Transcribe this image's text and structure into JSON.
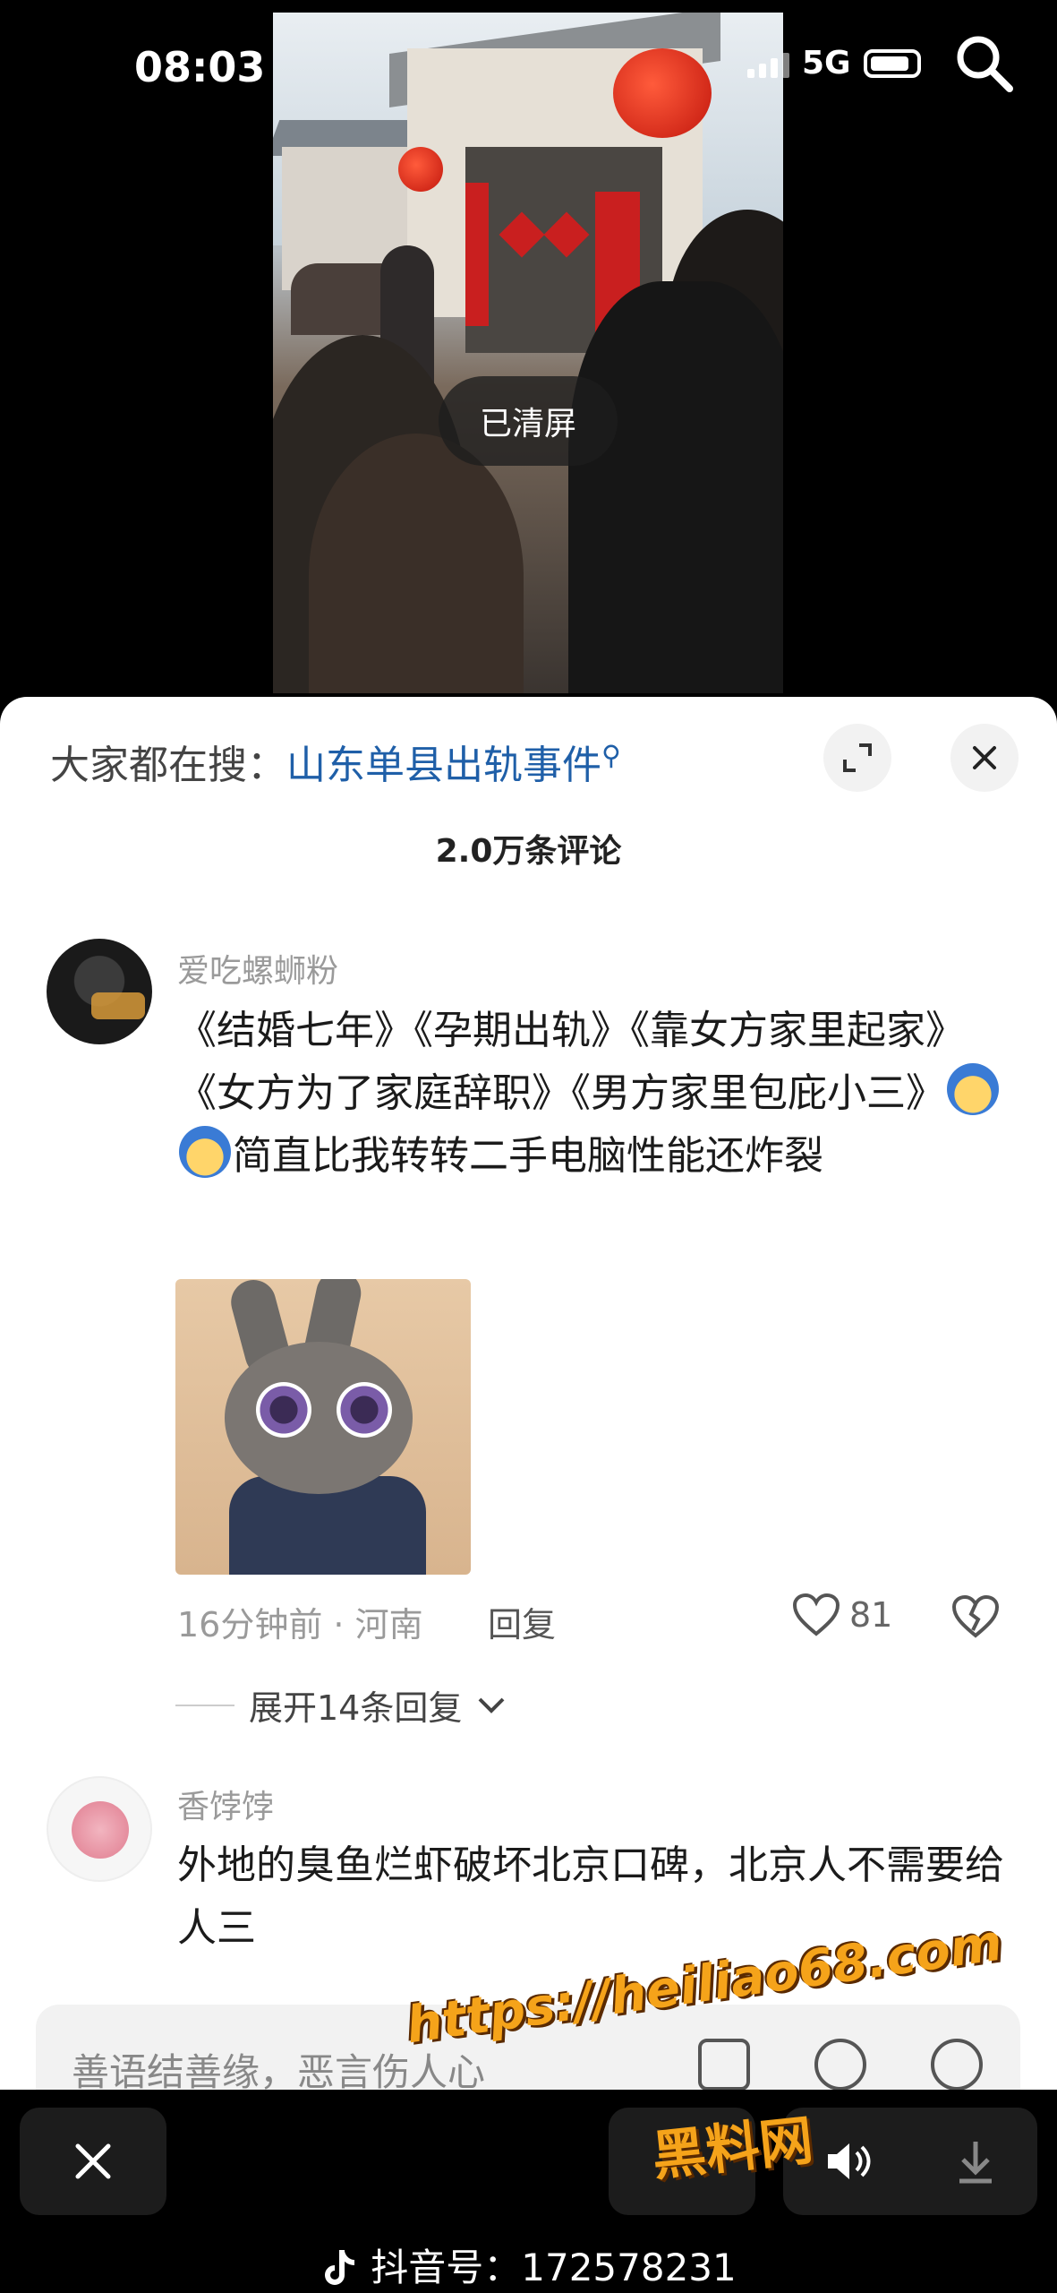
{
  "status_bar": {
    "time": "08:03",
    "network": "5G"
  },
  "video": {
    "clear_screen_badge": "已清屏"
  },
  "sheet": {
    "hot_search_prefix": "大家都在搜：",
    "hot_search_term": "山东单县出轨事件",
    "comment_count": "2.0万条评论"
  },
  "comments": [
    {
      "username": "爱吃螺蛳粉",
      "text_part1": "《结婚七年》《孕期出轨》《靠女方家里起家》《女方为了家庭辞职》《男方家里包庇小三》",
      "text_part2": "简直比我转转二手电脑性能还炸裂",
      "time_location": "16分钟前 · 河南",
      "reply_label": "回复",
      "likes": "81",
      "expand_replies": "展开14条回复"
    },
    {
      "username": "香饽饽",
      "text": "外地的臭鱼烂虾破坏北京口碑，北京人不需要给人三"
    }
  ],
  "input": {
    "placeholder": "善语结善缘，恶言伤人心"
  },
  "bottom_bar": {
    "douyin_id": "抖音号：172578231"
  },
  "watermark": {
    "url": "https://heiliao68.com",
    "site_name": "黑料网"
  },
  "colors": {
    "link": "#1f5fa8",
    "watermark": "#f5a31a"
  }
}
